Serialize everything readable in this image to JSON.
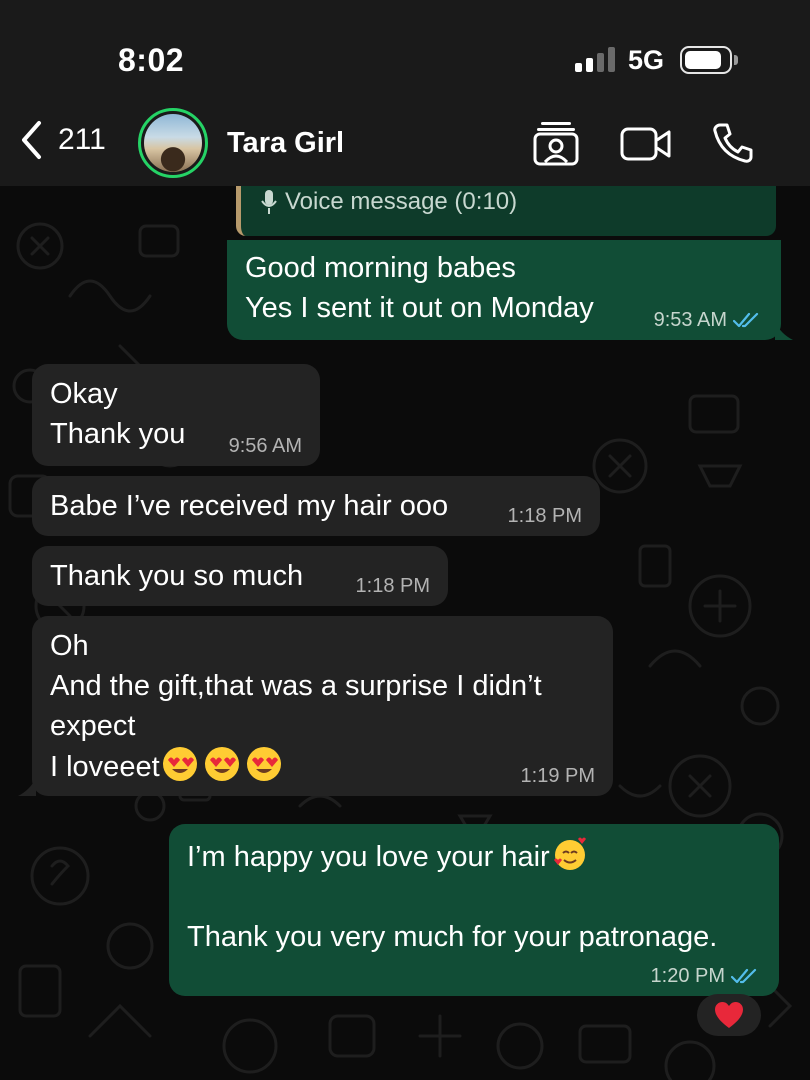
{
  "status_bar": {
    "time": "8:02",
    "network": "5G"
  },
  "header": {
    "back_count": "211",
    "contact_name": "Tara Girl"
  },
  "messages": [
    {
      "dir": "out",
      "quote": "Voice message (0:10)",
      "lines": [
        "Good morning babes",
        "Yes I sent it out on Monday"
      ],
      "time": "9:53 AM",
      "read": true
    },
    {
      "dir": "in",
      "lines": [
        "Okay",
        "Thank you"
      ],
      "time": "9:56 AM"
    },
    {
      "dir": "in",
      "lines": [
        "Babe I’ve received my hair ooo"
      ],
      "time": "1:18 PM"
    },
    {
      "dir": "in",
      "lines": [
        "Thank you so much"
      ],
      "time": "1:18 PM"
    },
    {
      "dir": "in",
      "lines": [
        "Oh",
        "And the gift,that was a surprise I didn’t",
        "expect",
        "I loveeet"
      ],
      "time": "1:19 PM"
    },
    {
      "dir": "out",
      "lines": [
        "I’m happy you love your hair",
        "",
        "Thank you very much for your patronage."
      ],
      "time": "1:20 PM",
      "read": true
    }
  ],
  "icons": {
    "back": "chevron-left-icon",
    "status": "status-icon",
    "video": "video-camera-icon",
    "call": "phone-icon",
    "voice": "microphone-icon",
    "read": "double-check-icon",
    "reaction": "heart-icon"
  },
  "colors": {
    "incoming_bubble": "#232323",
    "outgoing_bubble": "#114d36",
    "read_ticks": "#53bdeb",
    "avatar_ring": "#25d366",
    "reaction_heart": "#e8283a"
  }
}
